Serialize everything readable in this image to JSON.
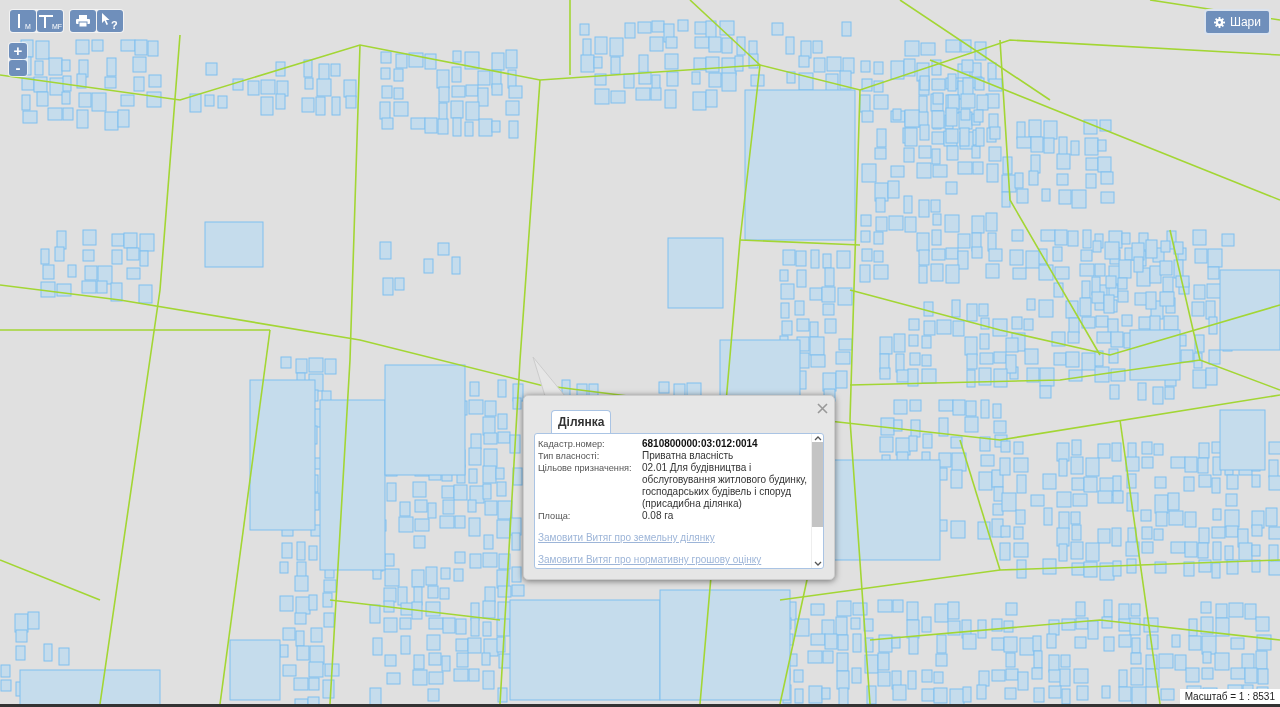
{
  "toolbar": {
    "buttons": [
      {
        "kind": "line-measure",
        "label": "M"
      },
      {
        "kind": "area-measure",
        "label": "MF"
      },
      {
        "kind": "print"
      },
      {
        "kind": "identify",
        "label": "?"
      }
    ]
  },
  "zoom": {
    "in": "+",
    "out": "-"
  },
  "layers_button": {
    "label": "Шари"
  },
  "popup": {
    "tabs": [
      {
        "label": "Ділянка",
        "selected": true
      }
    ],
    "fields": [
      {
        "label": "Кадастр.номер:",
        "value": "6810800000:03:012:0014",
        "emphasis": true
      },
      {
        "label": "Тип власності:",
        "value": "Приватна власність",
        "emphasis": false
      },
      {
        "label": "Цільове призначення:",
        "value": "02.01 Для будівництва і обслуговування житлового будинку, господарських будівель і споруд (присадибна ділянка)",
        "emphasis": false
      },
      {
        "label": "Площа:",
        "value": "0.08 га",
        "emphasis": false
      }
    ],
    "links": [
      "Замовити Витяг про земельну ділянку",
      "Замовити Витяг про нормативну грошову оцінку"
    ]
  },
  "scale": {
    "label": "Масштаб = 1 : 8531"
  }
}
